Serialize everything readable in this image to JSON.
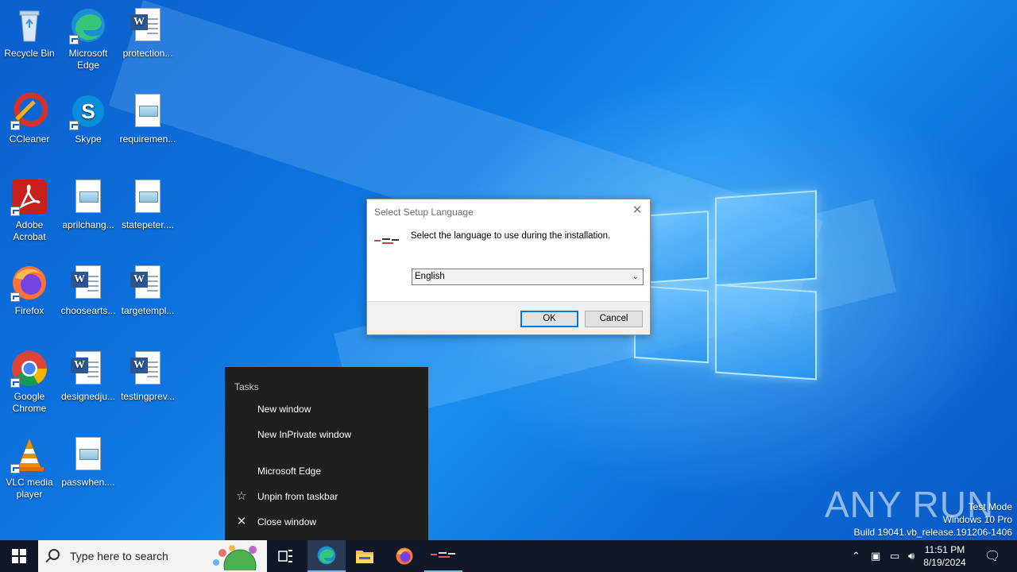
{
  "desktop": {
    "icons": [
      {
        "label": "Recycle Bin"
      },
      {
        "label": "Microsoft Edge"
      },
      {
        "label": "protection..."
      },
      {
        "label": "CCleaner"
      },
      {
        "label": "Skype"
      },
      {
        "label": "requiremen..."
      },
      {
        "label": "Adobe Acrobat"
      },
      {
        "label": "aprilchang..."
      },
      {
        "label": "statepeter...."
      },
      {
        "label": "Firefox"
      },
      {
        "label": "choosearts..."
      },
      {
        "label": "targetempl..."
      },
      {
        "label": "Google Chrome"
      },
      {
        "label": "designedju..."
      },
      {
        "label": "testingprev..."
      },
      {
        "label": "VLC media player"
      },
      {
        "label": "passwhen...."
      }
    ]
  },
  "dialog": {
    "title": "Select Setup Language",
    "prompt": "Select the language to use during the installation.",
    "language_selected": "English",
    "ok_label": "OK",
    "cancel_label": "Cancel"
  },
  "jumplist": {
    "header": "Tasks",
    "tasks": [
      "New window",
      "New InPrivate window"
    ],
    "app_name": "Microsoft Edge",
    "unpin_label": "Unpin from taskbar",
    "close_label": "Close window"
  },
  "watermark": {
    "brand": "ANY RUN",
    "line1": "Test Mode",
    "line2": "Windows 10 Pro",
    "line3": "Build 19041.vb_release.191206-1406"
  },
  "taskbar": {
    "search_placeholder": "Type here to search",
    "time": "11:51 PM",
    "date": "8/19/2024"
  },
  "colors": {
    "accent": "#0078d7",
    "taskbar": "#101827",
    "jumplist": "#1f1f1f"
  }
}
